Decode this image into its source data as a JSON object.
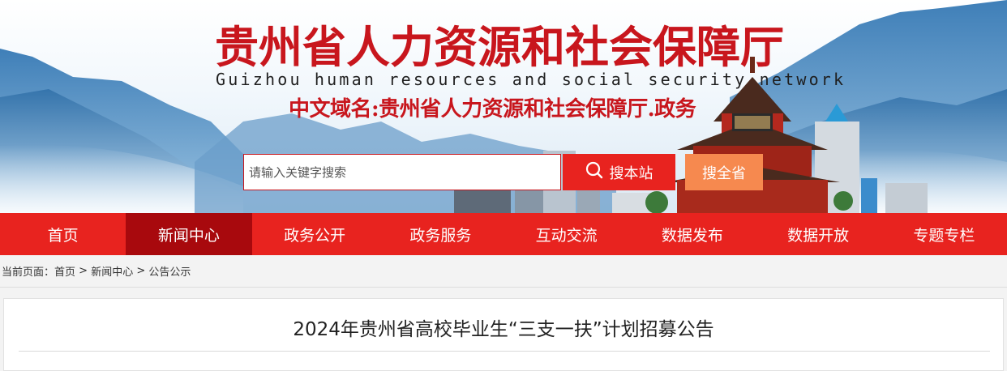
{
  "header": {
    "title": "贵州省人力资源和社会保障厅",
    "subtitle": "Guizhou human resources and social security network",
    "domain_label": "中文域名:贵州省人力资源和社会保障厅.政务"
  },
  "search": {
    "placeholder": "请输入关键字搜索",
    "value": "",
    "site_button": "搜本站",
    "all_button": "搜全省",
    "site_icon": "search-icon"
  },
  "nav": {
    "items": [
      "首页",
      "新闻中心",
      "政务公开",
      "政务服务",
      "互动交流",
      "数据发布",
      "数据开放",
      "专题专栏"
    ],
    "active": "新闻中心"
  },
  "breadcrumb": {
    "prefix": "当前页面：",
    "items": [
      "首页",
      "新闻中心",
      "公告公示"
    ],
    "separator": ">"
  },
  "article": {
    "title": "2024年贵州省高校毕业生“三支一扶”计划招募公告"
  },
  "colors": {
    "brand_red": "#e8231f",
    "active_nav": "#a8090d",
    "title_red": "#c8161d",
    "search_all": "#f6894f"
  }
}
